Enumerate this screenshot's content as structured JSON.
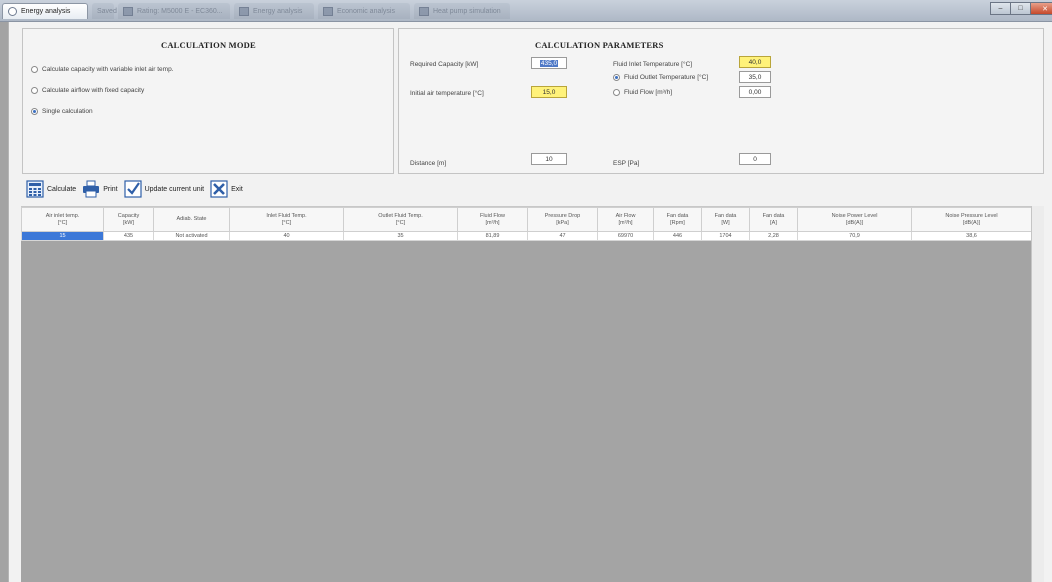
{
  "tabs": [
    {
      "label": "Energy analysis",
      "state": "active"
    },
    {
      "label": "Saved",
      "state": "dim"
    },
    {
      "label": "Rating: M5000 E - EC360...",
      "state": "dim"
    },
    {
      "label": "Energy analysis",
      "state": "dim"
    },
    {
      "label": "Economic analysis",
      "state": "dim"
    },
    {
      "label": "Heat pump simulation",
      "state": "dim"
    }
  ],
  "window_controls": {
    "minimize": "–",
    "maximize": "□",
    "close": "✕"
  },
  "mode_panel": {
    "title": "CALCULATION MODE",
    "options": [
      {
        "label": "Calculate capacity with variable inlet air temp.",
        "selected": false
      },
      {
        "label": "Calculate airflow with fixed capacity",
        "selected": false
      },
      {
        "label": "Single calculation",
        "selected": true
      }
    ]
  },
  "params_panel": {
    "title": "CALCULATION PARAMETERS",
    "required_capacity_label": "Required Capacity [kW]",
    "required_capacity_value": "435,0",
    "initial_air_temp_label": "Initial air temperature [°C]",
    "initial_air_temp_value": "15,0",
    "fluid_inlet_temp_label": "Fluid Inlet Temperature [°C]",
    "fluid_inlet_temp_value": "40,0",
    "fluid_outlet_temp_label": "Fluid Outlet Temperature [°C]",
    "fluid_outlet_temp_value": "35,0",
    "fluid_outlet_selected": true,
    "fluid_flow_label": "Fluid Flow [m³/h]",
    "fluid_flow_value": "0,00",
    "fluid_flow_selected": false,
    "distance_label": "Distance [m]",
    "distance_value": "10",
    "esp_label": "ESP [Pa]",
    "esp_value": "0"
  },
  "toolbar": {
    "calculate": "Calculate",
    "print": "Print",
    "update": "Update current unit",
    "exit": "Exit"
  },
  "table": {
    "headers": [
      [
        "Air inlet temp.",
        "[°C]"
      ],
      [
        "Capacity",
        "[kW]"
      ],
      [
        "Adiab. State",
        ""
      ],
      [
        "Inlet Fluid Temp.",
        "[°C]"
      ],
      [
        "Outlet Fluid Temp.",
        "[°C]"
      ],
      [
        "Fluid Flow",
        "[m³/h]"
      ],
      [
        "Pressure Drop",
        "[kPa]"
      ],
      [
        "Air Flow",
        "[m³/h]"
      ],
      [
        "Fan data",
        "[Rpm]"
      ],
      [
        "Fan data",
        "[W]"
      ],
      [
        "Fan data",
        "[A]"
      ],
      [
        "Noise Power Level",
        "[dB(A)]"
      ],
      [
        "Noise Pressure Level",
        "[dB(A)]"
      ]
    ],
    "rows": [
      [
        "15",
        "435",
        "Not activated",
        "40",
        "35",
        "81,89",
        "47",
        "69970",
        "446",
        "1704",
        "2,28",
        "70,9",
        "38,6"
      ]
    ]
  },
  "colors": {
    "highlight_yellow": "#fff27a",
    "selection_blue": "#3c78d8",
    "workspace_gray": "#a4a4a4"
  }
}
